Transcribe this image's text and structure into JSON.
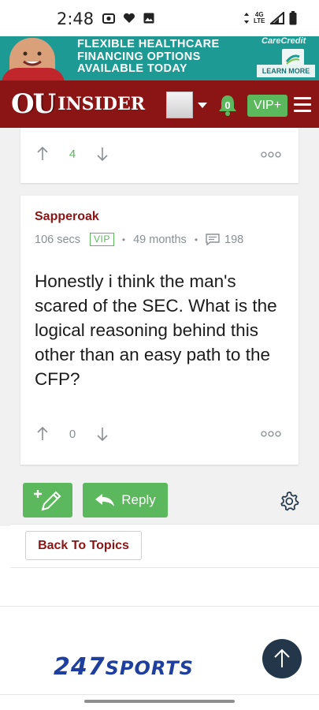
{
  "status_bar": {
    "time": "2:48",
    "network": [
      "4G",
      "LTE"
    ]
  },
  "ad": {
    "headline": [
      "FLEXIBLE HEALTHCARE",
      "FINANCING OPTIONS",
      "AVAILABLE TODAY"
    ],
    "brand": "CareCredit",
    "cta": "LEARN MORE"
  },
  "nav": {
    "logo_ou": "OU",
    "logo_insider": "INSIDER",
    "notification_count": "0",
    "vip_label": "VIP+"
  },
  "previous_post": {
    "upvotes": "4"
  },
  "post": {
    "author": "Sapperoak",
    "time_ago": "106 secs",
    "vip_badge": "VIP",
    "membership": "49 months",
    "post_count": "198",
    "body": "Honestly i think the man's scared of the SEC. What is the logical reasoning behind this other than an easy path to the CFP?",
    "votes": "0"
  },
  "actions": {
    "reply_label": "Reply"
  },
  "back_to_topics": "Back To Topics",
  "footer": {
    "logo_number": "247",
    "logo_word": "SPORTS"
  },
  "colors": {
    "brand_red": "#8b1414",
    "vip_green": "#5cb85c",
    "ad_teal": "#1d9a94"
  }
}
